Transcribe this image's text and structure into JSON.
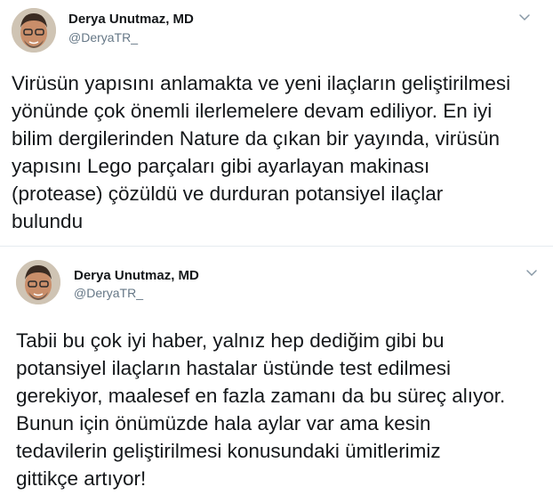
{
  "tweets": [
    {
      "author": {
        "name": "Derya Unutmaz, MD",
        "handle": "@DeryaTR_"
      },
      "text": "Virüsün yapısını anlamakta ve yeni ilaçların geliştirilmesi\nyönünde çok önemli ilerlemelere devam ediliyor. En iyi\nbilim dergilerinden Nature da çıkan bir yayında, virüsün\nyapısını Lego parçaları gibi ayarlayan makinası\n(protease) çözüldü ve durduran potansiyel ilaçlar\nbulundu",
      "menu_icon": "chevron-down-icon"
    },
    {
      "author": {
        "name": "Derya Unutmaz, MD",
        "handle": "@DeryaTR_"
      },
      "text": "Tabii bu çok iyi haber, yalnız hep dediğim gibi bu\npotansiyel ilaçların hastalar üstünde test edilmesi\ngerekiyor, maalesef en fazla zamanı da bu süreç alıyor.\nBunun için önümüzde hala aylar var ama kesin\ntedavilerin geliştirilmesi konusundaki ümitlerimiz\ngittikçe artıyor!",
      "menu_icon": "chevron-down-icon"
    }
  ],
  "colors": {
    "text": "#14171a",
    "secondary": "#657786",
    "divider": "#e6ecf0"
  }
}
